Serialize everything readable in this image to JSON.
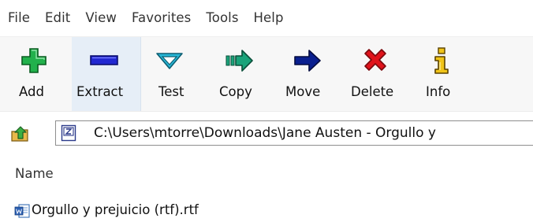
{
  "menu": {
    "items": [
      "File",
      "Edit",
      "View",
      "Favorites",
      "Tools",
      "Help"
    ]
  },
  "toolbar": {
    "buttons": [
      {
        "label": "Add",
        "icon": "add-icon",
        "color": "#22b14c"
      },
      {
        "label": "Extract",
        "icon": "extract-icon",
        "color": "#2127d1"
      },
      {
        "label": "Test",
        "icon": "test-icon",
        "color": "#27b8d8"
      },
      {
        "label": "Copy",
        "icon": "copy-icon",
        "color": "#1aa37a"
      },
      {
        "label": "Move",
        "icon": "move-icon",
        "color": "#0a1f8f"
      },
      {
        "label": "Delete",
        "icon": "delete-icon",
        "color": "#e0131b"
      },
      {
        "label": "Info",
        "icon": "info-icon",
        "color": "#d9a400"
      }
    ]
  },
  "address": {
    "path": "C:\\Users\\mtorre\\Downloads\\Jane Austen - Orgullo y"
  },
  "file_list": {
    "column_name": "Name",
    "files": [
      {
        "name": "Orgullo y prejuicio (rtf).rtf",
        "icon": "document-icon"
      }
    ]
  }
}
